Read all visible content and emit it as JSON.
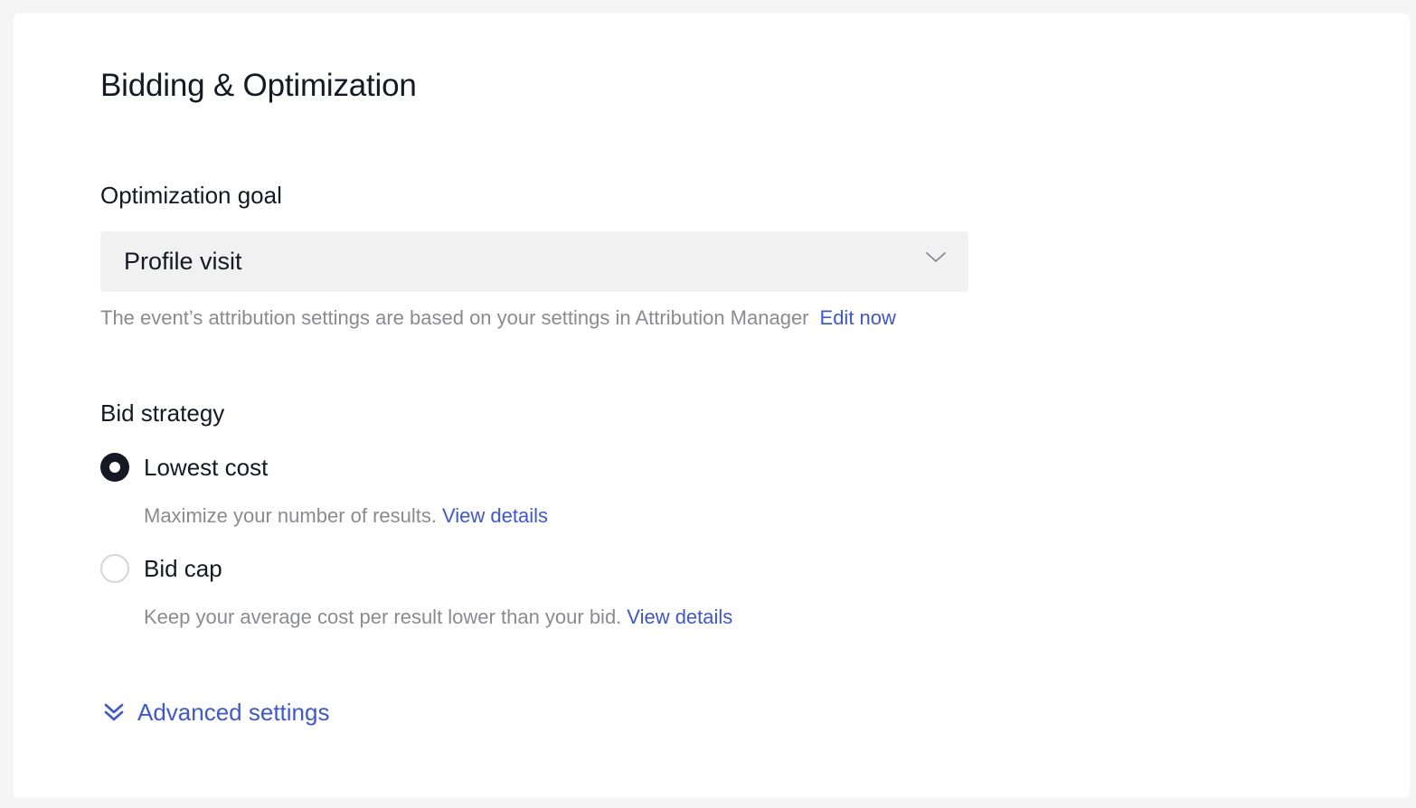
{
  "section": {
    "title": "Bidding & Optimization"
  },
  "optimization_goal": {
    "label": "Optimization goal",
    "selected": "Profile visit",
    "hint": "The event’s attribution settings are based on your settings in Attribution Manager",
    "hint_link": "Edit now"
  },
  "bid_strategy": {
    "label": "Bid strategy",
    "options": [
      {
        "label": "Lowest cost",
        "checked": true,
        "description": "Maximize your number of results.",
        "link": "View details"
      },
      {
        "label": "Bid cap",
        "checked": false,
        "description": "Keep your average cost per result lower than your bid.",
        "link": "View details"
      }
    ]
  },
  "advanced": {
    "label": "Advanced settings",
    "icon": "double-chevron-down-icon"
  },
  "colors": {
    "link": "#3b55e6",
    "text": "#161823",
    "muted": "#8a8b91",
    "select_bg": "#f1f1f2"
  }
}
